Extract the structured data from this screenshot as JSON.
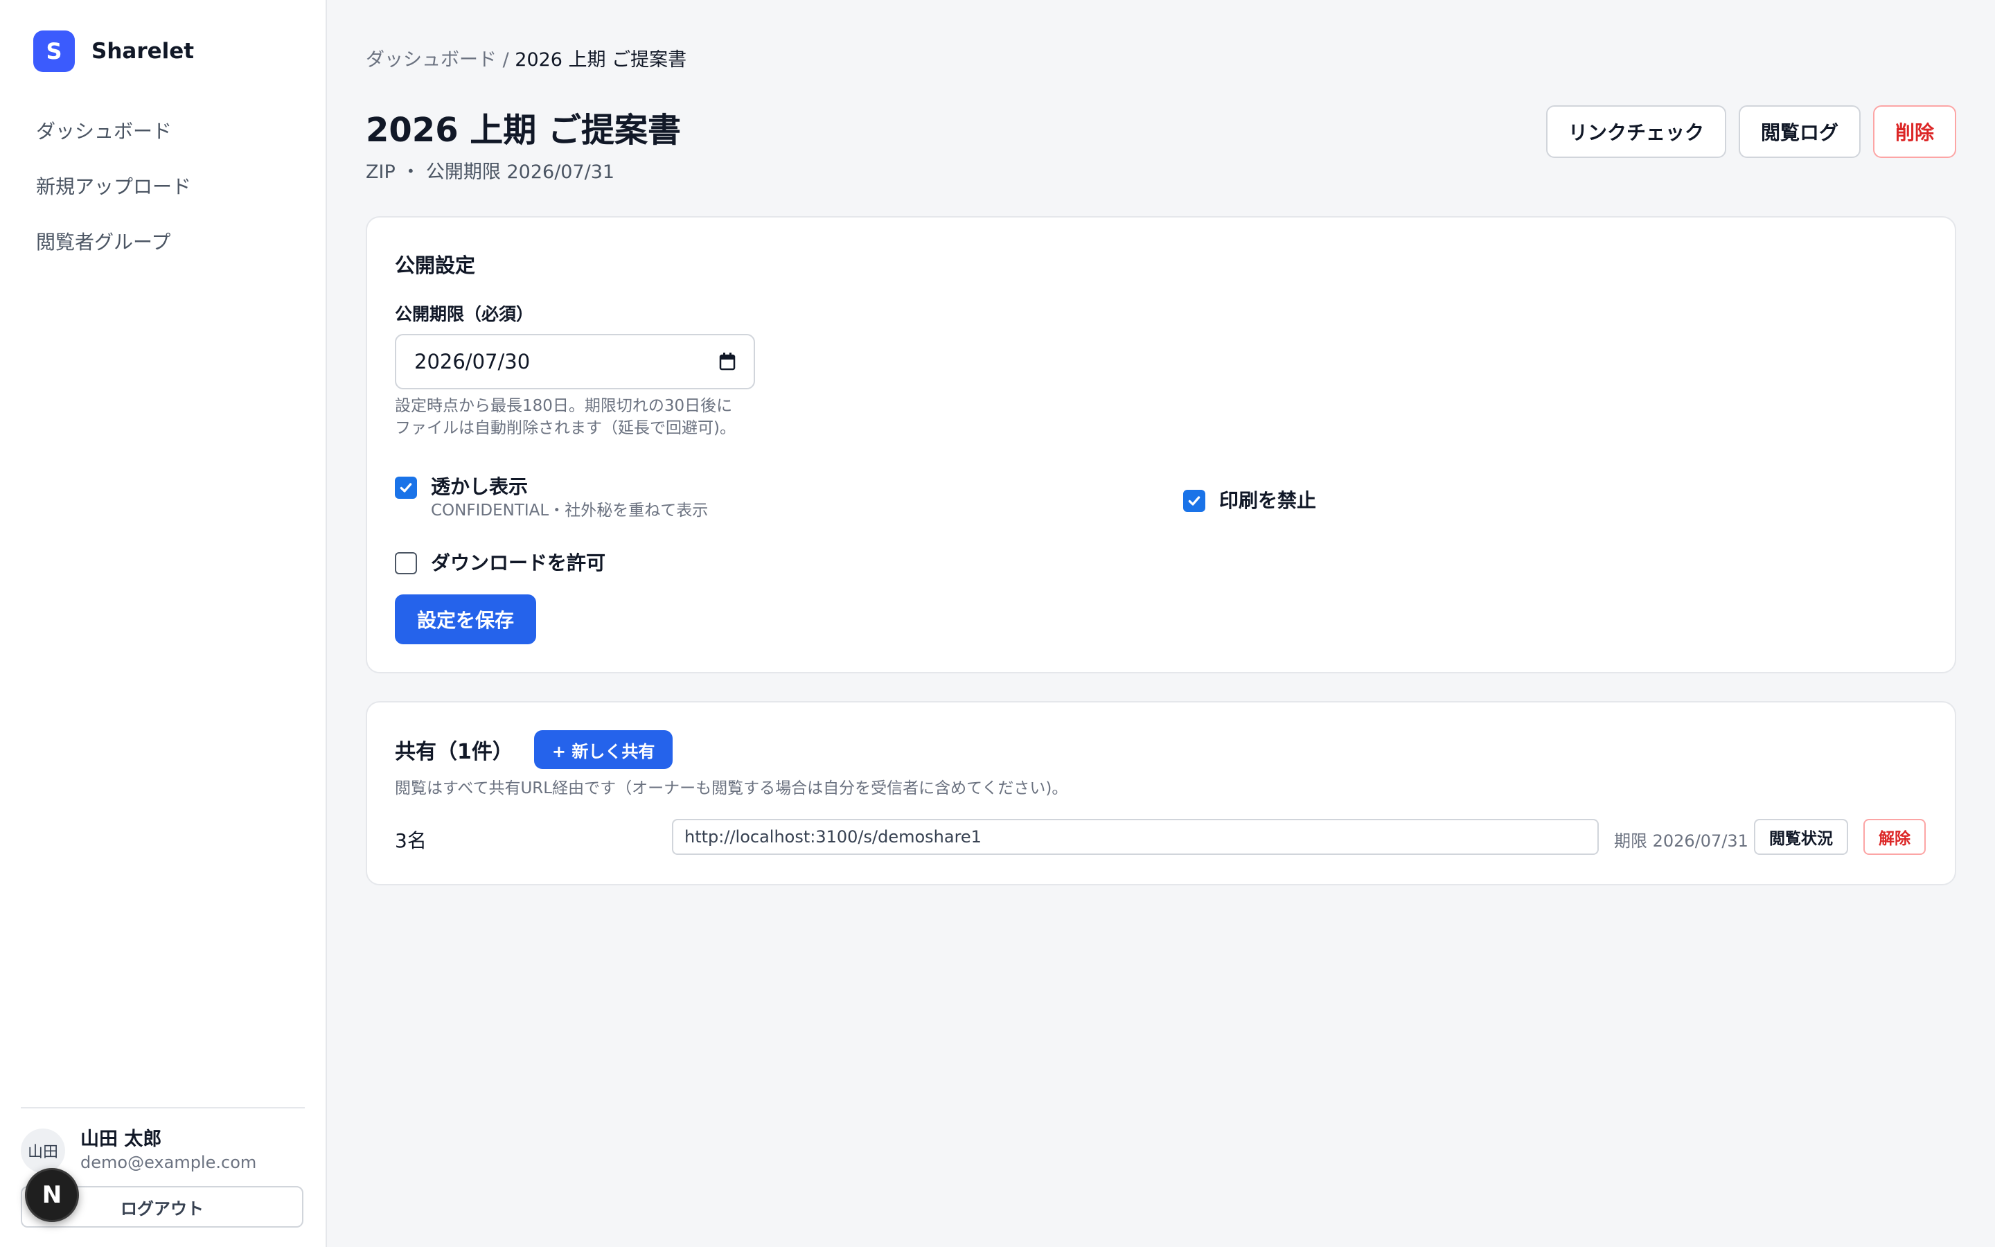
{
  "brand": {
    "logo_letter": "S",
    "name": "Sharelet",
    "accent": "#3b5bfd"
  },
  "sidebar": {
    "items": [
      {
        "label": "ダッシュボード"
      },
      {
        "label": "新規アップロード"
      },
      {
        "label": "閲覧者グループ"
      }
    ]
  },
  "user": {
    "avatar_text": "山田",
    "name": "山田 太郎",
    "email": "demo@example.com",
    "logout_label": "ログアウト"
  },
  "dev_badge": {
    "letter": "N"
  },
  "breadcrumb": {
    "parent": "ダッシュボード",
    "separator": " / ",
    "current": "2026 上期 ご提案書"
  },
  "page": {
    "title": "2026 上期 ご提案書",
    "meta": "ZIP ・ 公開期限 2026/07/31"
  },
  "header_actions": {
    "link_check_label": "リンクチェック",
    "view_log_label": "閲覧ログ",
    "delete_label": "削除"
  },
  "settings": {
    "title": "公開設定",
    "expiry_label": "公開期限（必須）",
    "expiry_value": "2026/07/30",
    "hint_line1": "設定時点から最長180日。期限切れの30日後に",
    "hint_line2": "ファイルは自動削除されます（延長で回避可)。",
    "watermark": {
      "label": "透かし表示",
      "sub": "CONFIDENTIAL・社外秘を重ねて表示",
      "checked": true
    },
    "no_print": {
      "label": "印刷を禁止",
      "checked": true
    },
    "allow_download": {
      "label": "ダウンロードを許可",
      "checked": false
    },
    "save_label": "設定を保存"
  },
  "share": {
    "title": "共有（1件）",
    "new_share_label": "+ 新しく共有",
    "description": "閲覧はすべて共有URL経由です（オーナーも閲覧する場合は自分を受信者に含めてください)。",
    "rows": [
      {
        "recipients": "3名",
        "url": "http://localhost:3100/s/demoshare1",
        "expiry": "期限 2026/07/31",
        "status_label": "閲覧状況",
        "revoke_label": "解除"
      }
    ]
  },
  "colors": {
    "primary": "#2563eb",
    "danger": "#dc2626",
    "checkbox": "#1a73e8"
  }
}
